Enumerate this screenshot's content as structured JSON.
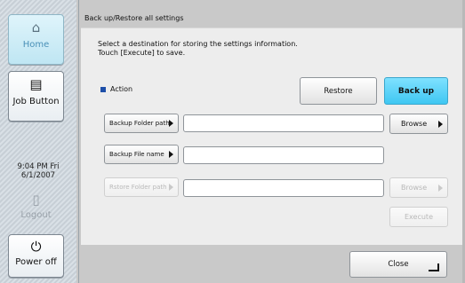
{
  "sidebar": {
    "home_label": "Home",
    "job_label": "Job Button",
    "date_time": "9:04 PM  Fri\n6/1/2007",
    "time": "9:04 PM  Fri",
    "date": "6/1/2007",
    "logout_label": "Logout",
    "power_label": "Power off"
  },
  "screen": {
    "title": "Back up/Restore all settings",
    "instruction_line1": "Select a destination for storing the settings information.",
    "instruction_line2": "Touch [Execute] to save.",
    "action_label": "Action",
    "restore_label": "Restore",
    "backup_label": "Back up",
    "backup_folder_label": "Backup Folder path",
    "backup_file_label": "Backup File name",
    "restore_folder_label": "Rstore Folder path",
    "browse_label": "Browse",
    "browse_disabled_label": "Browse",
    "execute_label": "Execute",
    "close_label": "Close"
  },
  "fields": {
    "backup_folder_value": "",
    "backup_file_value": "",
    "restore_folder_value": ""
  },
  "colors": {
    "accent": "#3fc7f2",
    "bullet": "#1d4fa8"
  },
  "icons": [
    "home-icon",
    "job-button-icon",
    "logout-icon",
    "power-icon",
    "arrow-right-icon",
    "enter-icon"
  ]
}
